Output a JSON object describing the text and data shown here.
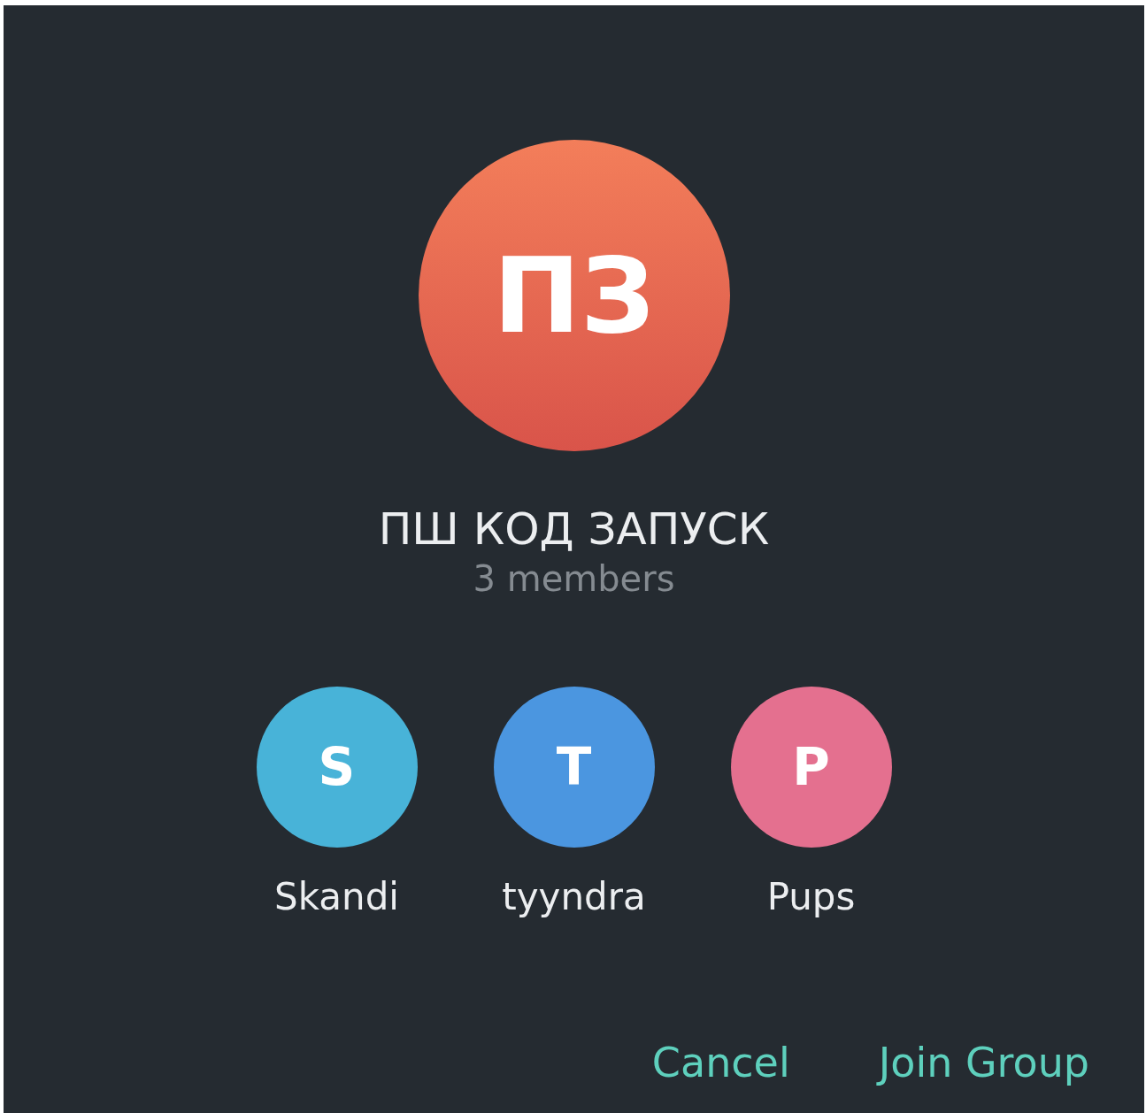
{
  "group": {
    "initials": "ПЗ",
    "title": "ПШ КОД ЗАПУСК",
    "members_count": "3 members"
  },
  "members": [
    {
      "initial": "S",
      "name": "Skandi",
      "color": "#48b3d8"
    },
    {
      "initial": "T",
      "name": "tyyndra",
      "color": "#4b96e0"
    },
    {
      "initial": "P",
      "name": "Pups",
      "color": "#e4708f"
    }
  ],
  "buttons": [
    {
      "label": "Cancel"
    },
    {
      "label": "Join Group"
    }
  ]
}
